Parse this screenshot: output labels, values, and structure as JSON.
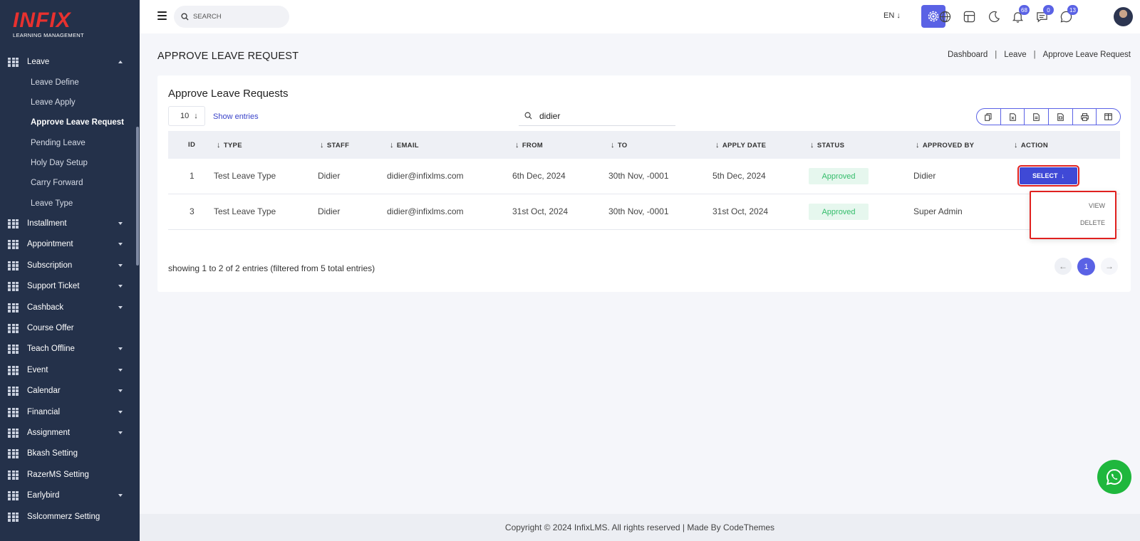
{
  "brand": {
    "logo_text": "INFIX",
    "logo_sub": "LEARNING MANAGEMENT",
    "accent": "#5a62e5",
    "logo_color": "#e8312f"
  },
  "sidebar": {
    "open_section": "Leave",
    "sub_items": [
      {
        "label": "Leave Define",
        "active": false
      },
      {
        "label": "Leave Apply",
        "active": false
      },
      {
        "label": "Approve Leave Request",
        "active": true
      },
      {
        "label": "Pending Leave",
        "active": false
      },
      {
        "label": "Holy Day Setup",
        "active": false
      },
      {
        "label": "Carry Forward",
        "active": false
      },
      {
        "label": "Leave Type",
        "active": false
      }
    ],
    "items": [
      {
        "label": "Installment",
        "expandable": true
      },
      {
        "label": "Appointment",
        "expandable": true
      },
      {
        "label": "Subscription",
        "expandable": true
      },
      {
        "label": "Support Ticket",
        "expandable": true
      },
      {
        "label": "Cashback",
        "expandable": true
      },
      {
        "label": "Course Offer",
        "expandable": false
      },
      {
        "label": "Teach Offline",
        "expandable": true
      },
      {
        "label": "Event",
        "expandable": true
      },
      {
        "label": "Calendar",
        "expandable": true
      },
      {
        "label": "Financial",
        "expandable": true
      },
      {
        "label": "Assignment",
        "expandable": true
      },
      {
        "label": "Bkash Setting",
        "expandable": false
      },
      {
        "label": "RazerMS Setting",
        "expandable": false
      },
      {
        "label": "Earlybird",
        "expandable": true
      },
      {
        "label": "Sslcommerz Setting",
        "expandable": false
      }
    ]
  },
  "topbar": {
    "search_placeholder": "SEARCH",
    "language": "EN",
    "notifications_count": "68",
    "messages_count": "0",
    "chat_count": "13"
  },
  "page": {
    "title": "APPROVE LEAVE REQUEST",
    "breadcrumb": [
      "Dashboard",
      "Leave",
      "Approve Leave Request"
    ]
  },
  "card": {
    "title": "Approve Leave Requests",
    "entries_value": "10",
    "entries_label": "Show entries",
    "search_value": "didier",
    "columns": [
      "ID",
      "TYPE",
      "STAFF",
      "EMAIL",
      "FROM",
      "TO",
      "APPLY DATE",
      "STATUS",
      "APPROVED BY",
      "ACTION"
    ],
    "rows": [
      {
        "id": "1",
        "type": "Test Leave Type",
        "staff": "Didier",
        "email": "didier@infixlms.com",
        "from": "6th Dec, 2024",
        "to": "30th Nov, -0001",
        "apply_date": "5th Dec, 2024",
        "status": "Approved",
        "approved_by": "Didier"
      },
      {
        "id": "3",
        "type": "Test Leave Type",
        "staff": "Didier",
        "email": "didier@infixlms.com",
        "from": "31st Oct, 2024",
        "to": "30th Nov, -0001",
        "apply_date": "31st Oct, 2024",
        "status": "Approved",
        "approved_by": "Super Admin"
      }
    ],
    "action_label": "SELECT",
    "dropdown": [
      "VIEW",
      "DELETE"
    ],
    "showing_text": "showing 1 to 2 of 2 entries (filtered from 5 total entries)",
    "current_page": "1"
  },
  "footer": {
    "text": "Copyright © 2024 InfixLMS. All rights reserved | Made By CodeThemes"
  }
}
